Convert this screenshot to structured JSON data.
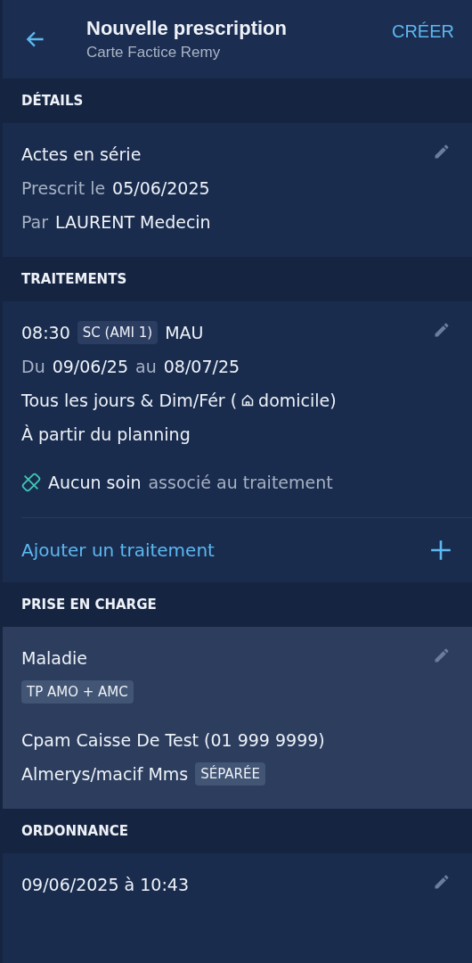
{
  "header": {
    "title": "Nouvelle prescription",
    "subtitle": "Carte Factice Remy",
    "action": "CRÉER"
  },
  "sections": [
    {
      "title": "DÉTAILS",
      "cards": [
        {
          "highlighted": false,
          "groups": [
            [
              [
                {
                  "text": "Actes en série",
                  "kind": "normal"
                }
              ],
              [
                {
                  "text": "Prescrit le",
                  "kind": "muted"
                },
                {
                  "text": "05/06/2025",
                  "kind": "normal"
                }
              ],
              [
                {
                  "text": "Par",
                  "kind": "muted"
                },
                {
                  "text": "LAURENT Medecin",
                  "kind": "normal"
                }
              ]
            ]
          ]
        }
      ]
    },
    {
      "title": "TRAITEMENTS",
      "cards": [
        {
          "highlighted": false,
          "groups": [
            [
              [
                {
                  "text": "08:30",
                  "kind": "normal"
                },
                {
                  "text": "SC (AMI 1)",
                  "kind": "tag"
                },
                {
                  "text": "MAU",
                  "kind": "normal"
                }
              ],
              [
                {
                  "text": "Du",
                  "kind": "muted"
                },
                {
                  "text": "09/06/25",
                  "kind": "normal"
                },
                {
                  "text": "au",
                  "kind": "muted"
                },
                {
                  "text": "08/07/25",
                  "kind": "normal"
                }
              ],
              [
                {
                  "text": "Tous les jours & Dim/Fér (",
                  "kind": "normal"
                },
                {
                  "kind": "home"
                },
                {
                  "text": "domicile)",
                  "kind": "normal"
                }
              ],
              [
                {
                  "text": "À partir du planning",
                  "kind": "normal"
                }
              ]
            ],
            [
              [
                {
                  "kind": "bandage"
                },
                {
                  "text": "Aucun soin",
                  "kind": "normal"
                },
                {
                  "text": "associé au traitement",
                  "kind": "muted"
                }
              ]
            ]
          ],
          "add_action": "Ajouter un traitement"
        }
      ]
    },
    {
      "title": "PRISE EN CHARGE",
      "cards": [
        {
          "highlighted": true,
          "groups": [
            [
              [
                {
                  "text": "Maladie",
                  "kind": "normal"
                }
              ],
              [
                {
                  "text": "TP AMO + AMC",
                  "kind": "tag"
                }
              ]
            ],
            [
              [
                {
                  "text": "Cpam Caisse De Test (01 999 9999)",
                  "kind": "normal"
                }
              ],
              [
                {
                  "text": "Almerys/macif Mms",
                  "kind": "normal"
                },
                {
                  "text": "SÉPARÉE",
                  "kind": "tag"
                }
              ]
            ]
          ]
        }
      ]
    },
    {
      "title": "ORDONNANCE",
      "cards": [
        {
          "highlighted": false,
          "groups": [
            [
              [
                {
                  "text": "09/06/2025 à 10:43",
                  "kind": "normal"
                }
              ]
            ]
          ]
        }
      ]
    }
  ]
}
